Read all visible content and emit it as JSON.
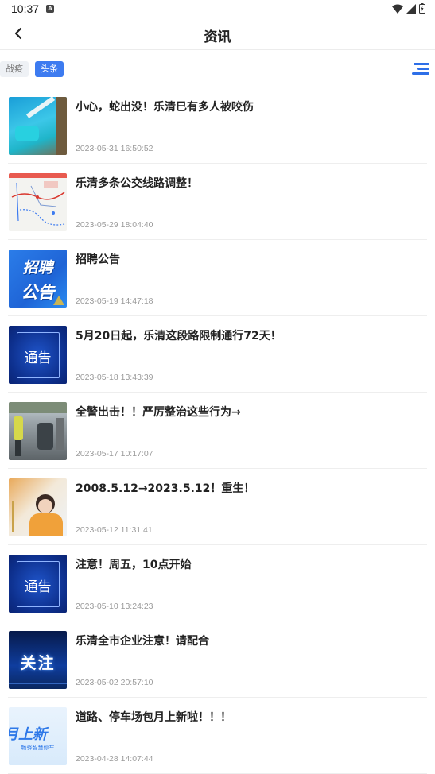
{
  "status_bar": {
    "time": "10:37",
    "notif_glyph": "A"
  },
  "nav": {
    "title": "资讯",
    "back_icon": "chevron-left-icon"
  },
  "tabs": [
    {
      "label": "战疫",
      "active": false
    },
    {
      "label": "头条",
      "active": true
    }
  ],
  "menu_icon": "menu-list-icon",
  "news": [
    {
      "title": "小心，蛇出没！乐清已有多人被咬伤",
      "date": "2023-05-31 16:50:52",
      "thumb": "photo"
    },
    {
      "title": "乐清多条公交线路调整！",
      "date": "2023-05-29 18:04:40",
      "thumb": "map"
    },
    {
      "title": "招聘公告",
      "date": "2023-05-19 14:47:18",
      "thumb": "banner",
      "thumb_text": [
        "招聘",
        "公告"
      ]
    },
    {
      "title": "5月20日起，乐清这段路限制通行72天！",
      "date": "2023-05-18 13:43:39",
      "thumb": "notice",
      "thumb_text": [
        "通告"
      ]
    },
    {
      "title": "全警出击！！严厉整治这些行为→",
      "date": "2023-05-17 10:17:07",
      "thumb": "street"
    },
    {
      "title": "2008.5.12→2023.5.12！重生！",
      "date": "2023-05-12 11:31:41",
      "thumb": "person"
    },
    {
      "title": "注意！周五，10点开始",
      "date": "2023-05-10 13:24:23",
      "thumb": "notice",
      "thumb_text": [
        "通告"
      ]
    },
    {
      "title": "乐清全市企业注意！请配合",
      "date": "2023-05-02 20:57:10",
      "thumb": "attention",
      "thumb_text": [
        "关注"
      ]
    },
    {
      "title": "道路、停车场包月上新啦！！！",
      "date": "2023-04-28 14:07:44",
      "thumb": "parking",
      "thumb_text": [
        "月上新",
        "畅驿智慧停车"
      ]
    }
  ]
}
